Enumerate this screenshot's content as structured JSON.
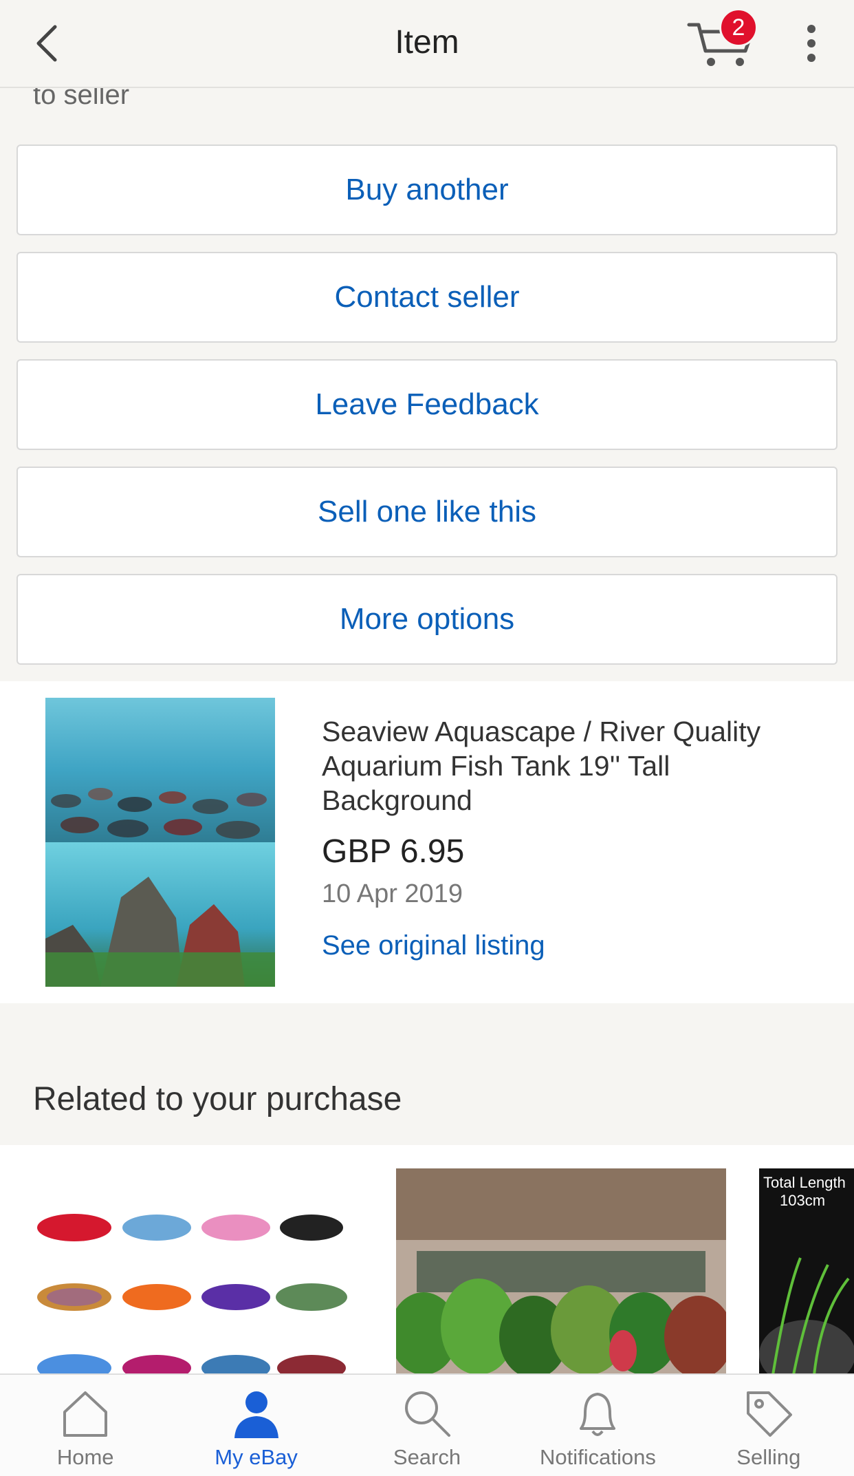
{
  "header": {
    "title": "Item",
    "cart_count": "2"
  },
  "partial_text": "to seller",
  "actions": [
    {
      "label": "Buy another"
    },
    {
      "label": "Contact seller"
    },
    {
      "label": "Leave Feedback"
    },
    {
      "label": "Sell one like this"
    },
    {
      "label": "More options"
    }
  ],
  "item": {
    "title": "Seaview Aquascape / River Quality Aquarium Fish Tank 19'' Tall Background",
    "price": "GBP 6.95",
    "date": "10 Apr 2019",
    "link": "See original listing"
  },
  "related": {
    "heading": "Related to your purchase",
    "card3_text_1": "Total Length",
    "card3_text_2": "103cm"
  },
  "nav": [
    {
      "label": "Home",
      "icon": "home-icon"
    },
    {
      "label": "My eBay",
      "icon": "person-icon"
    },
    {
      "label": "Search",
      "icon": "search-icon"
    },
    {
      "label": "Notifications",
      "icon": "bell-icon"
    },
    {
      "label": "Selling",
      "icon": "tag-icon"
    }
  ],
  "colors": {
    "accent": "#0b5fb8",
    "active_nav": "#1a5fd6",
    "badge": "#e0102c"
  }
}
